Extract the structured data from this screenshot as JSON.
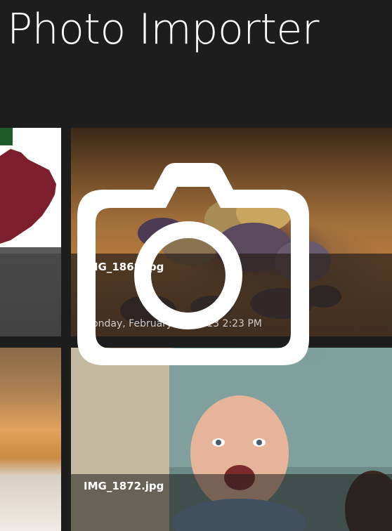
{
  "app": {
    "title": "Photo Importer"
  },
  "photos": [
    {
      "file_name": "",
      "date": ""
    },
    {
      "file_name": "IMG_1868.jpg",
      "date": "Monday, February 18, 2013 2:23 PM"
    },
    {
      "file_name": "",
      "date": ""
    },
    {
      "file_name": "IMG_1872.jpg",
      "date": ""
    }
  ],
  "overlay": {
    "icon": "camera-icon"
  },
  "colors": {
    "background": "#1d1d1d",
    "title_text": "#ffffff",
    "overlay_icon": "#ffffff"
  }
}
